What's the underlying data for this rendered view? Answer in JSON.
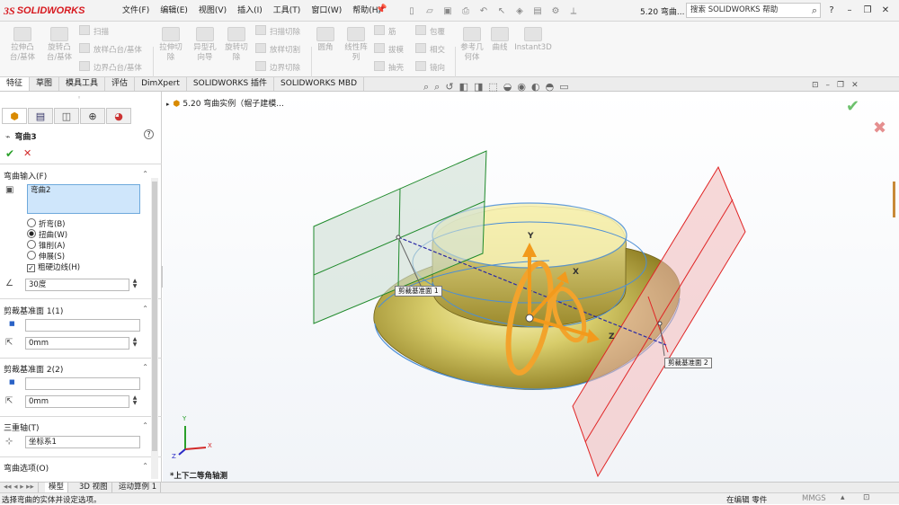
{
  "app": {
    "brand_prefix": "3S",
    "brand_name": "SOLIDWORKS"
  },
  "menu": [
    "文件(F)",
    "编辑(E)",
    "视图(V)",
    "插入(I)",
    "工具(T)",
    "窗口(W)",
    "帮助(H)"
  ],
  "doc_title": "5.20 弯曲...",
  "search": {
    "placeholder": "搜索 SOLIDWORKS 帮助"
  },
  "ribbon": {
    "big": [
      {
        "label": "拉伸凸\n台/基体"
      },
      {
        "label": "旋转凸\n台/基体"
      },
      {
        "label": "拉伸切\n除"
      },
      {
        "label": "异型孔\n向导"
      },
      {
        "label": "旋转切\n除"
      },
      {
        "label": "圆角"
      },
      {
        "label": "线性阵\n列"
      },
      {
        "label": "参考几\n何体"
      },
      {
        "label": "曲线"
      },
      {
        "label": "Instant3D"
      }
    ],
    "small": [
      "扫描",
      "放样凸台/基体",
      "边界凸台/基体",
      "扫描切除",
      "放样切割",
      "边界切除",
      "筋",
      "拔模",
      "抽壳",
      "包覆",
      "相交",
      "镜向"
    ]
  },
  "tabs": [
    "特征",
    "草图",
    "模具工具",
    "评估",
    "DimXpert",
    "SOLIDWORKS 插件",
    "SOLIDWORKS MBD"
  ],
  "tree": {
    "root_label": "5.20 弯曲实例（帽子建模..."
  },
  "panel": {
    "title": "弯曲3",
    "sections": {
      "input": "弯曲输入(F)",
      "trim1": "剪裁基准面 1(1)",
      "trim2": "剪裁基准面 2(2)",
      "triad": "三重轴(T)",
      "options": "弯曲选项(O)"
    },
    "input_value": "弯曲2",
    "modes": [
      "折弯(B)",
      "扭曲(W)",
      "锥削(A)",
      "伸展(S)"
    ],
    "selected_mode": "扭曲(W)",
    "hard_edges": "粗硬边线(H)",
    "angle": "30度",
    "trim1_dist": "0mm",
    "trim2_dist": "0mm",
    "triad_value": "坐标系1"
  },
  "viewport": {
    "callout1": "剪裁基准面 1",
    "callout2": "剪裁基准面 2",
    "view_label": "*上下二等角轴测",
    "axis_y": "Y",
    "axis_x": "X",
    "axis_z": "Z",
    "triad_y": "Y",
    "triad_x": "X",
    "triad_z": "Z"
  },
  "bottom_tabs": [
    "模型",
    "3D 视图",
    "运动算例 1"
  ],
  "status": {
    "left": "选择弯曲的实体并设定选项。",
    "editing": "在编辑 零件",
    "units": "MMGS"
  },
  "colors": {
    "accent": "#d7191f",
    "ok": "#2aa02a",
    "cancel": "#d22a2a",
    "selection": "#cfe6fb"
  }
}
